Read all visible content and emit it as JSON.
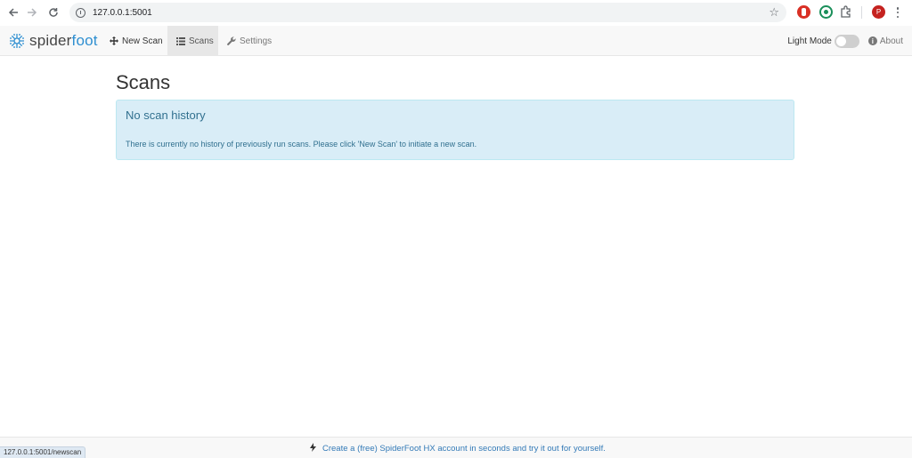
{
  "browser": {
    "url": "127.0.0.1:5001",
    "profile_initial": "P"
  },
  "navbar": {
    "brand_part1": "spider",
    "brand_part2": "foot",
    "items": [
      {
        "label": "New Scan",
        "icon": "move-arrows-icon"
      },
      {
        "label": "Scans",
        "icon": "list-icon",
        "active": true
      },
      {
        "label": "Settings",
        "icon": "wrench-icon"
      }
    ],
    "light_mode_label": "Light Mode",
    "light_mode_on": false,
    "about_label": "About"
  },
  "main": {
    "title": "Scans",
    "alert": {
      "heading": "No scan history",
      "body": "There is currently no history of previously run scans. Please click 'New Scan' to initiate a new scan."
    }
  },
  "footer": {
    "promo": "Create a (free) SpiderFoot HX account in seconds and try it out for yourself."
  },
  "status_bar": {
    "hover_url": "127.0.0.1:5001/newscan"
  },
  "colors": {
    "brand_accent": "#2f8fd1",
    "alert_bg": "#d9edf7",
    "alert_text": "#31708f",
    "link": "#337ab7"
  }
}
